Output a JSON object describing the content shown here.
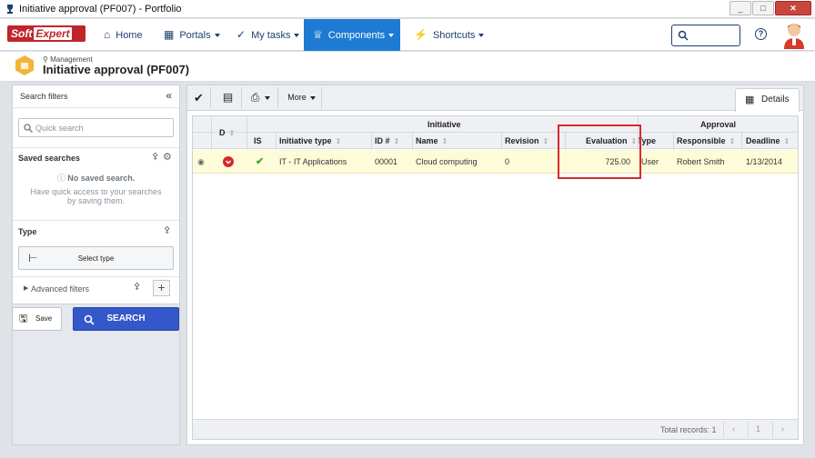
{
  "window": {
    "title": "Initiative approval (PF007) - Portfolio"
  },
  "nav": {
    "logo": {
      "text1": "Soft",
      "text2": "Expert"
    },
    "items": [
      {
        "label": "Home"
      },
      {
        "label": "Portals"
      },
      {
        "label": "My tasks"
      },
      {
        "label": "Components"
      },
      {
        "label": "Shortcuts"
      }
    ],
    "help": "?"
  },
  "page": {
    "breadcrumb": "Management",
    "title": "Initiative approval (PF007)"
  },
  "filters": {
    "title": "Search filters",
    "quick_search_placeholder": "Quick search",
    "saved_searches_title": "Saved searches",
    "no_saved_title": "No saved search.",
    "no_saved_desc": "Have quick access to your searches by saving them.",
    "type_title": "Type",
    "select_type": "Select type",
    "advanced": "Advanced filters",
    "save": "Save",
    "search": "SEARCH"
  },
  "toolbar": {
    "more": "More",
    "details_tab": "Details"
  },
  "grid": {
    "group_headers": {
      "initiative": "Initiative",
      "approval": "Approval"
    },
    "columns": {
      "d": "D",
      "is": "IS",
      "initiative_type": "Initiative type",
      "id": "ID #",
      "name": "Name",
      "revision": "Revision",
      "evaluation": "Evaluation",
      "type": "Type",
      "responsible": "Responsible",
      "deadline": "Deadline"
    },
    "rows": [
      {
        "initiative_type": "IT - IT Applications",
        "id": "00001",
        "name": "Cloud computing",
        "revision": "0",
        "evaluation": "725.00",
        "type": "User",
        "responsible": "Robert Smith",
        "deadline": "1/13/2014"
      }
    ],
    "total_records": "Total records: 1",
    "page_prev": "‹",
    "page_num": "1",
    "page_next": "›"
  },
  "colors": {
    "accent": "#1e7bd3",
    "search_button": "#3458c9",
    "row_highlight": "#fefcd8",
    "annotation": "#d52b2b"
  }
}
